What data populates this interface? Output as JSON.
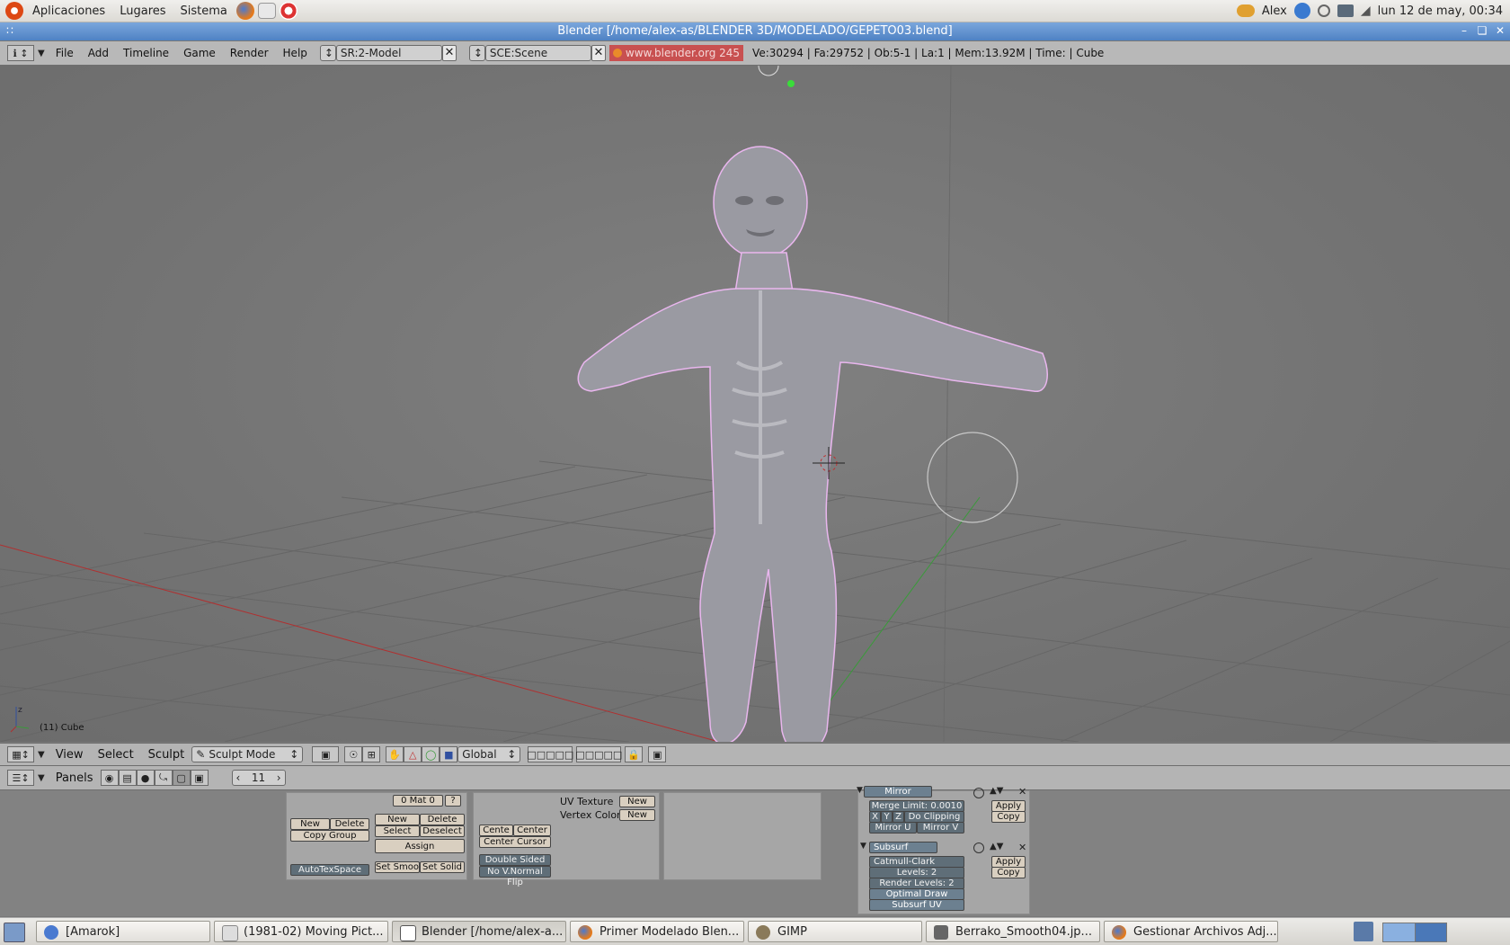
{
  "top_panel": {
    "menus": [
      "Aplicaciones",
      "Lugares",
      "Sistema"
    ],
    "user": "Alex",
    "clock": "lun 12 de may, 00:34"
  },
  "window": {
    "title": "Blender [/home/alex-as/BLENDER 3D/MODELADO/GEPETO03.blend]"
  },
  "info_header": {
    "menus": [
      "File",
      "Add",
      "Timeline",
      "Game",
      "Render",
      "Help"
    ],
    "screen": "SR:2-Model",
    "scene": "SCE:Scene",
    "link": "www.blender.org 245",
    "stats": "Ve:30294 | Fa:29752 | Ob:5-1 | La:1  | Mem:13.92M  | Time: | Cube"
  },
  "viewport": {
    "object_label": "(11) Cube",
    "axis_z": "z"
  },
  "view3d_header": {
    "menus": [
      "View",
      "Select",
      "Sculpt"
    ],
    "mode": "Sculpt Mode",
    "orientation": "Global"
  },
  "buttons_header": {
    "label": "Panels",
    "frame": "11"
  },
  "link_materials": {
    "mat_field": "0 Mat 0",
    "help": "?",
    "new": "New",
    "delete": "Delete",
    "copy_group": "Copy Group",
    "mat_new": "New",
    "mat_delete": "Delete",
    "select": "Select",
    "deselect": "Deselect",
    "assign": "Assign",
    "autotexspace": "AutoTexSpace",
    "set_smooth": "Set Smoo",
    "set_solid": "Set Solid"
  },
  "mesh_panel": {
    "centre": "Cente",
    "centre_new": "Center Ne",
    "center_cursor": "Center Cursor",
    "double_sided": "Double Sided",
    "no_vnormal": "No V.Normal Flip",
    "uv_texture": "UV Texture",
    "vertex_color": "Vertex Color",
    "uv_new": "New",
    "vc_new": "New"
  },
  "modifiers": {
    "mirror_name": "Mirror",
    "merge_limit": "Merge Limit: 0.0010",
    "x": "X",
    "y": "Y",
    "z": "Z",
    "do_clipping": "Do Clipping",
    "mirror_u": "Mirror U",
    "mirror_v": "Mirror V",
    "apply": "Apply",
    "copy": "Copy",
    "subsurf_name": "Subsurf",
    "subsurf_type": "Catmull-Clark",
    "levels": "Levels: 2",
    "render_levels": "Render Levels: 2",
    "optimal_draw": "Optimal Draw",
    "subsurf_uv": "Subsurf UV",
    "apply2": "Apply",
    "copy2": "Copy"
  },
  "taskbar": {
    "tasks": [
      "[Amarok]",
      "(1981-02) Moving Pict...",
      "Blender [/home/alex-a...",
      "Primer Modelado Blen...",
      "GIMP",
      "Berrako_Smooth04.jp...",
      "Gestionar Archivos Adj..."
    ]
  },
  "colors": {
    "titlebar": "#5b8ccc",
    "viewport_bg": "#787878",
    "header_bg": "#b4b4b4",
    "link_bg": "#c85050",
    "x_axis": "#b83030",
    "y_axis": "#3a9a3a"
  }
}
